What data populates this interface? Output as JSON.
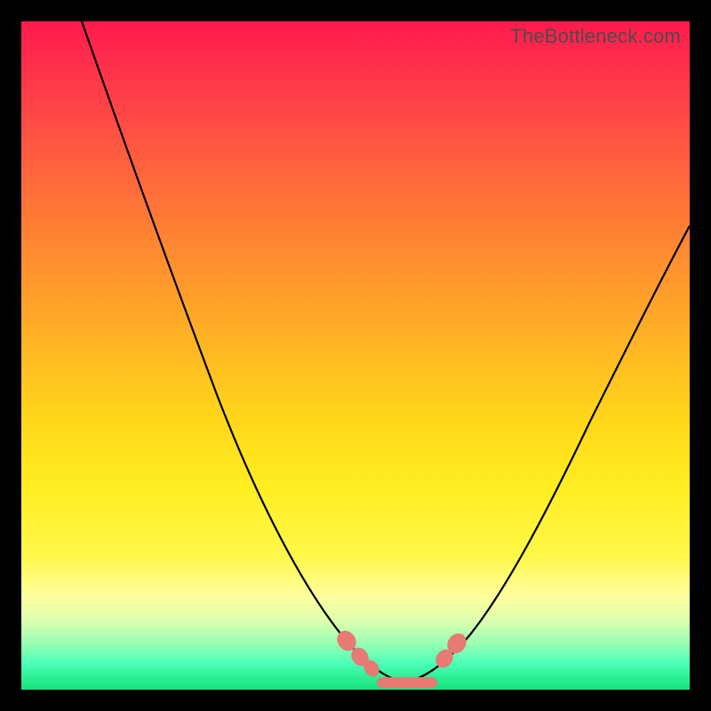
{
  "watermark": "TheBottleneck.com",
  "colors": {
    "frame": "#000000",
    "curve": "#000000",
    "bead": "#e77a73",
    "gradient_top": "#ff1a4d",
    "gradient_bottom": "#13e37a"
  },
  "chart_data": {
    "type": "line",
    "title": "",
    "xlabel": "",
    "ylabel": "",
    "xlim": [
      0,
      100
    ],
    "ylim": [
      0,
      100
    ],
    "series": [
      {
        "name": "left-curve",
        "x": [
          9,
          12,
          15,
          18,
          21,
          24,
          27,
          30,
          33,
          36,
          39,
          42,
          45,
          48,
          51,
          53,
          55,
          57
        ],
        "y": [
          100,
          92,
          84,
          76,
          68,
          60,
          52,
          44,
          36,
          28,
          21,
          15,
          10,
          6,
          3,
          2,
          1,
          0
        ]
      },
      {
        "name": "right-curve",
        "x": [
          57,
          60,
          63,
          66,
          69,
          72,
          75,
          78,
          82,
          86,
          90,
          95,
          100
        ],
        "y": [
          0,
          1,
          3,
          6,
          10,
          15,
          21,
          28,
          36,
          45,
          54,
          62,
          70
        ]
      }
    ],
    "markers": {
      "left_beads": [
        {
          "x": 49,
          "y": 6
        },
        {
          "x": 51,
          "y": 4
        },
        {
          "x": 52.5,
          "y": 2.5
        }
      ],
      "right_beads": [
        {
          "x": 63.5,
          "y": 4
        },
        {
          "x": 65,
          "y": 6
        }
      ],
      "bottom_bar": {
        "x0": 53,
        "x1": 62,
        "y": 0.6
      }
    }
  }
}
